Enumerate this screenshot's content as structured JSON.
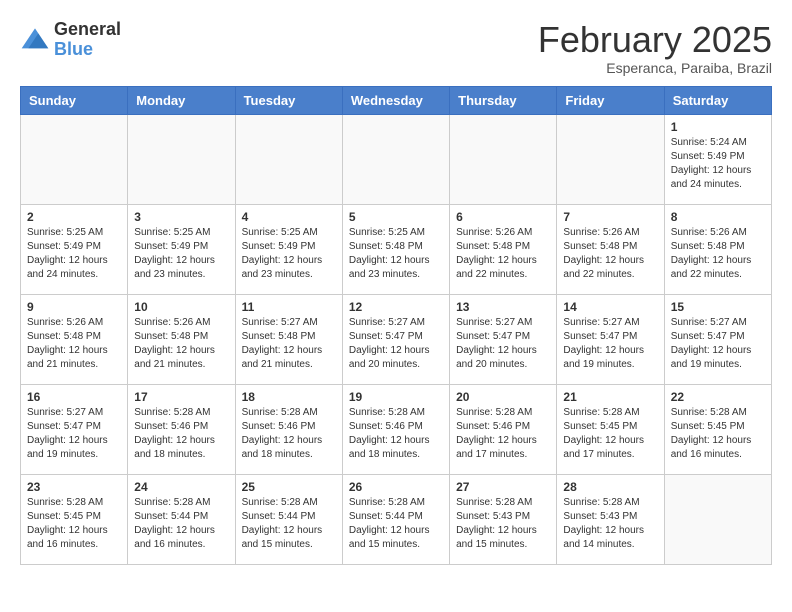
{
  "header": {
    "logo_general": "General",
    "logo_blue": "Blue",
    "month_title": "February 2025",
    "subtitle": "Esperanca, Paraiba, Brazil"
  },
  "days_of_week": [
    "Sunday",
    "Monday",
    "Tuesday",
    "Wednesday",
    "Thursday",
    "Friday",
    "Saturday"
  ],
  "weeks": [
    [
      {
        "day": "",
        "info": ""
      },
      {
        "day": "",
        "info": ""
      },
      {
        "day": "",
        "info": ""
      },
      {
        "day": "",
        "info": ""
      },
      {
        "day": "",
        "info": ""
      },
      {
        "day": "",
        "info": ""
      },
      {
        "day": "1",
        "info": "Sunrise: 5:24 AM\nSunset: 5:49 PM\nDaylight: 12 hours and 24 minutes."
      }
    ],
    [
      {
        "day": "2",
        "info": "Sunrise: 5:25 AM\nSunset: 5:49 PM\nDaylight: 12 hours and 24 minutes."
      },
      {
        "day": "3",
        "info": "Sunrise: 5:25 AM\nSunset: 5:49 PM\nDaylight: 12 hours and 23 minutes."
      },
      {
        "day": "4",
        "info": "Sunrise: 5:25 AM\nSunset: 5:49 PM\nDaylight: 12 hours and 23 minutes."
      },
      {
        "day": "5",
        "info": "Sunrise: 5:25 AM\nSunset: 5:48 PM\nDaylight: 12 hours and 23 minutes."
      },
      {
        "day": "6",
        "info": "Sunrise: 5:26 AM\nSunset: 5:48 PM\nDaylight: 12 hours and 22 minutes."
      },
      {
        "day": "7",
        "info": "Sunrise: 5:26 AM\nSunset: 5:48 PM\nDaylight: 12 hours and 22 minutes."
      },
      {
        "day": "8",
        "info": "Sunrise: 5:26 AM\nSunset: 5:48 PM\nDaylight: 12 hours and 22 minutes."
      }
    ],
    [
      {
        "day": "9",
        "info": "Sunrise: 5:26 AM\nSunset: 5:48 PM\nDaylight: 12 hours and 21 minutes."
      },
      {
        "day": "10",
        "info": "Sunrise: 5:26 AM\nSunset: 5:48 PM\nDaylight: 12 hours and 21 minutes."
      },
      {
        "day": "11",
        "info": "Sunrise: 5:27 AM\nSunset: 5:48 PM\nDaylight: 12 hours and 21 minutes."
      },
      {
        "day": "12",
        "info": "Sunrise: 5:27 AM\nSunset: 5:47 PM\nDaylight: 12 hours and 20 minutes."
      },
      {
        "day": "13",
        "info": "Sunrise: 5:27 AM\nSunset: 5:47 PM\nDaylight: 12 hours and 20 minutes."
      },
      {
        "day": "14",
        "info": "Sunrise: 5:27 AM\nSunset: 5:47 PM\nDaylight: 12 hours and 19 minutes."
      },
      {
        "day": "15",
        "info": "Sunrise: 5:27 AM\nSunset: 5:47 PM\nDaylight: 12 hours and 19 minutes."
      }
    ],
    [
      {
        "day": "16",
        "info": "Sunrise: 5:27 AM\nSunset: 5:47 PM\nDaylight: 12 hours and 19 minutes."
      },
      {
        "day": "17",
        "info": "Sunrise: 5:28 AM\nSunset: 5:46 PM\nDaylight: 12 hours and 18 minutes."
      },
      {
        "day": "18",
        "info": "Sunrise: 5:28 AM\nSunset: 5:46 PM\nDaylight: 12 hours and 18 minutes."
      },
      {
        "day": "19",
        "info": "Sunrise: 5:28 AM\nSunset: 5:46 PM\nDaylight: 12 hours and 18 minutes."
      },
      {
        "day": "20",
        "info": "Sunrise: 5:28 AM\nSunset: 5:46 PM\nDaylight: 12 hours and 17 minutes."
      },
      {
        "day": "21",
        "info": "Sunrise: 5:28 AM\nSunset: 5:45 PM\nDaylight: 12 hours and 17 minutes."
      },
      {
        "day": "22",
        "info": "Sunrise: 5:28 AM\nSunset: 5:45 PM\nDaylight: 12 hours and 16 minutes."
      }
    ],
    [
      {
        "day": "23",
        "info": "Sunrise: 5:28 AM\nSunset: 5:45 PM\nDaylight: 12 hours and 16 minutes."
      },
      {
        "day": "24",
        "info": "Sunrise: 5:28 AM\nSunset: 5:44 PM\nDaylight: 12 hours and 16 minutes."
      },
      {
        "day": "25",
        "info": "Sunrise: 5:28 AM\nSunset: 5:44 PM\nDaylight: 12 hours and 15 minutes."
      },
      {
        "day": "26",
        "info": "Sunrise: 5:28 AM\nSunset: 5:44 PM\nDaylight: 12 hours and 15 minutes."
      },
      {
        "day": "27",
        "info": "Sunrise: 5:28 AM\nSunset: 5:43 PM\nDaylight: 12 hours and 15 minutes."
      },
      {
        "day": "28",
        "info": "Sunrise: 5:28 AM\nSunset: 5:43 PM\nDaylight: 12 hours and 14 minutes."
      },
      {
        "day": "",
        "info": ""
      }
    ]
  ]
}
